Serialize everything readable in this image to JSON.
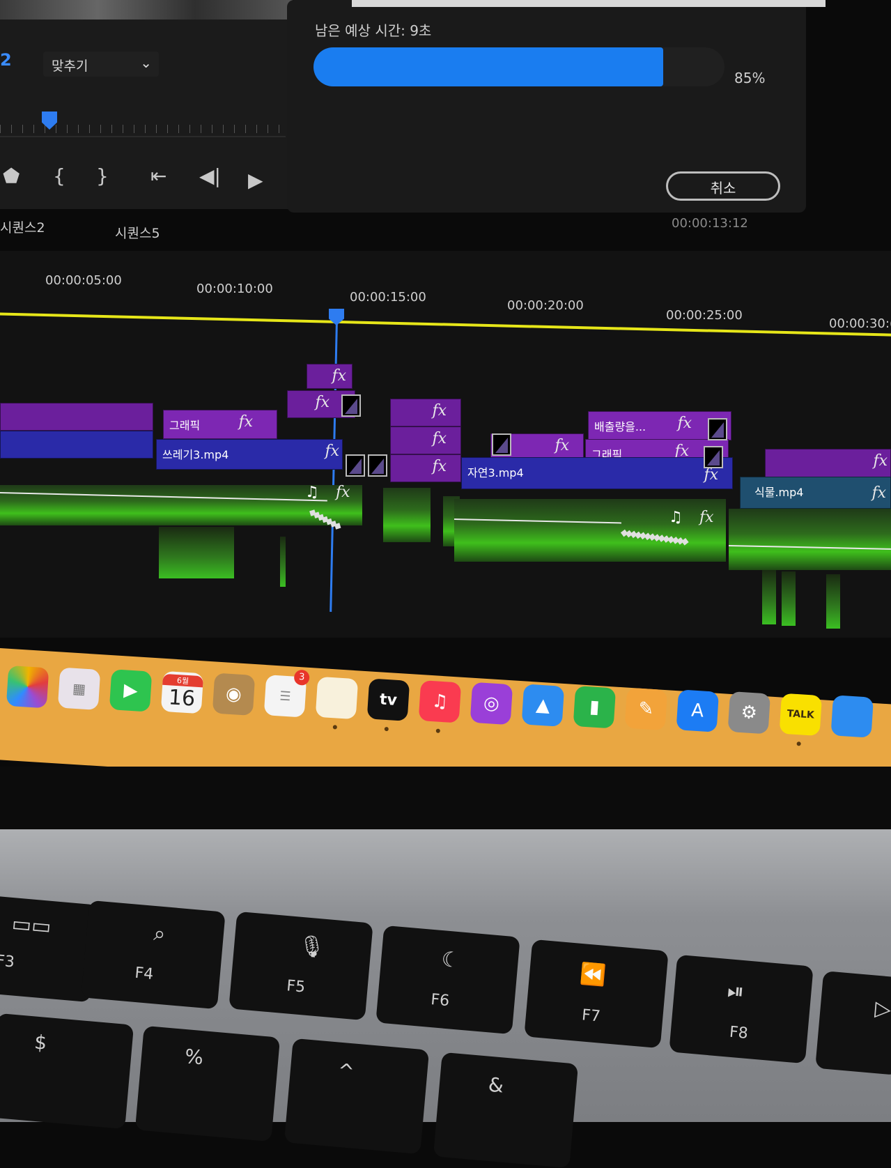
{
  "monitor": {
    "zoom_number": "2",
    "fit_dropdown_value": "맞추기"
  },
  "render_dialog": {
    "remaining_time": "남은 예상 시간: 9초",
    "progress_percent": "85%",
    "progress_value": 0.85,
    "cancel_label": "취소"
  },
  "sequence_tabs": [
    "시퀀스2",
    "시퀀스5"
  ],
  "current_timecode": "00:00:13:12",
  "ruler_ticks": [
    "00:00:05:00",
    "00:00:10:00",
    "00:00:15:00",
    "00:00:20:00",
    "00:00:25:00",
    "00:00:30:("
  ],
  "clips": {
    "graphic_1": "그래픽",
    "trash3": "쓰레기3.mp4",
    "nature3": "자연3.mp4",
    "emissions": "배출량을...",
    "graphic_2": "그래픽",
    "plants": "식물.mp4",
    "fx": "fx"
  },
  "dock": {
    "calendar_month": "6월",
    "calendar_day": "16",
    "reminders_badge": "3",
    "tv_label": "tv",
    "kakao_label": "TALK"
  },
  "keyboard": {
    "keys": [
      "F3",
      "F4",
      "F5",
      "F6",
      "F7",
      "F8"
    ],
    "symbols": [
      "$",
      "%",
      "^",
      "&"
    ]
  },
  "colors": {
    "accent_blue": "#1a7df0",
    "work_area_yellow": "#e6e619",
    "clip_purple": "#6b1f9c",
    "clip_blue": "#2a2aa8",
    "audio_green": "#3fbf1c",
    "dock_orange": "#e9a742"
  }
}
